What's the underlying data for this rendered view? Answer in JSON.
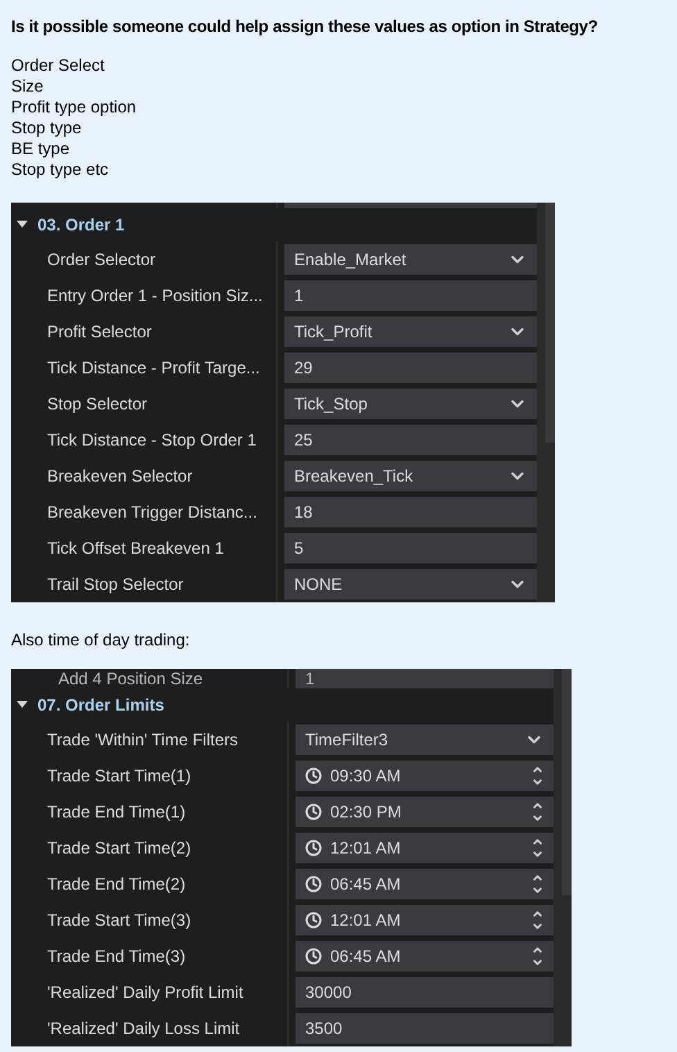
{
  "question": "Is it possible someone could help assign these values as option in Strategy?",
  "list_lines": [
    "Order Select",
    "Size",
    "Profit type option",
    "Stop type",
    "BE type",
    "Stop type etc"
  ],
  "panels": [
    {
      "section": {
        "title": "03. Order 1",
        "expanded": true
      },
      "rows": [
        {
          "label": "Order Selector",
          "kind": "dropdown",
          "value": "Enable_Market"
        },
        {
          "label": "Entry Order 1 - Position Siz...",
          "kind": "text",
          "value": "1"
        },
        {
          "label": "Profit Selector",
          "kind": "dropdown",
          "value": "Tick_Profit"
        },
        {
          "label": "Tick Distance - Profit Targe...",
          "kind": "text",
          "value": "29"
        },
        {
          "label": "Stop Selector",
          "kind": "dropdown",
          "value": "Tick_Stop"
        },
        {
          "label": "Tick Distance - Stop Order 1",
          "kind": "text",
          "value": "25"
        },
        {
          "label": "Breakeven Selector",
          "kind": "dropdown",
          "value": "Breakeven_Tick"
        },
        {
          "label": "Breakeven Trigger Distanc...",
          "kind": "text",
          "value": "18"
        },
        {
          "label": "Tick Offset Breakeven 1",
          "kind": "text",
          "value": "5"
        },
        {
          "label": "Trail Stop Selector",
          "kind": "dropdown",
          "value": "NONE"
        }
      ]
    },
    {
      "caption": "Also time of day trading:",
      "top_row": {
        "label": "Add 4 Position Size",
        "value": "1"
      },
      "section": {
        "title": "07. Order Limits",
        "expanded": true
      },
      "rows": [
        {
          "label": "Trade 'Within' Time Filters",
          "kind": "dropdown",
          "value": "TimeFilter3"
        },
        {
          "label": "Trade Start Time(1)",
          "kind": "time",
          "value": "09:30 AM"
        },
        {
          "label": "Trade End Time(1)",
          "kind": "time",
          "value": "02:30 PM"
        },
        {
          "label": "Trade Start Time(2)",
          "kind": "time",
          "value": "12:01 AM"
        },
        {
          "label": "Trade End Time(2)",
          "kind": "time",
          "value": "06:45 AM"
        },
        {
          "label": "Trade Start Time(3)",
          "kind": "time",
          "value": "12:01 AM"
        },
        {
          "label": "Trade End Time(3)",
          "kind": "time",
          "value": "06:45 AM"
        },
        {
          "label": "'Realized' Daily Profit Limit",
          "kind": "text",
          "value": "30000"
        },
        {
          "label": "'Realized' Daily Loss Limit",
          "kind": "text",
          "value": "3500"
        }
      ]
    }
  ]
}
